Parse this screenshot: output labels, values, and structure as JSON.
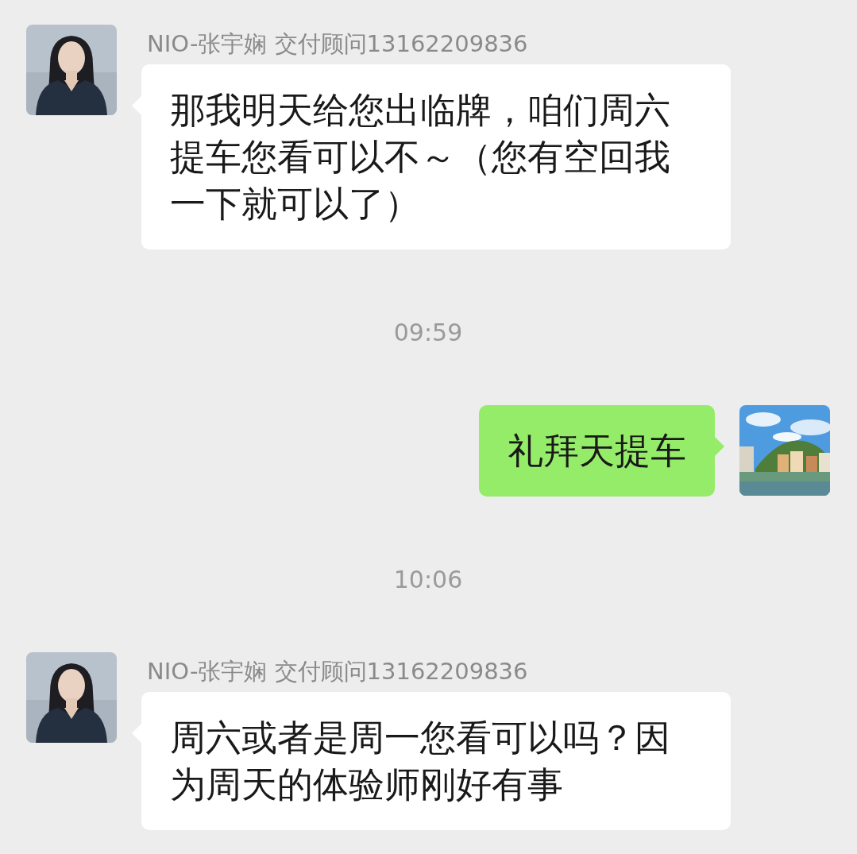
{
  "messages": [
    {
      "kind": "incoming",
      "sender": "NIO-张宇娴 交付顾问13162209836",
      "text": "那我明天给您出临牌，咱们周六提车您看可以不～（您有空回我一下就可以了）"
    },
    {
      "kind": "time",
      "text": "09:59"
    },
    {
      "kind": "outgoing",
      "text": "礼拜天提车"
    },
    {
      "kind": "time",
      "text": "10:06"
    },
    {
      "kind": "incoming",
      "sender": "NIO-张宇娴 交付顾问13162209836",
      "text": "周六或者是周一您看可以吗？因为周天的体验师刚好有事"
    }
  ]
}
